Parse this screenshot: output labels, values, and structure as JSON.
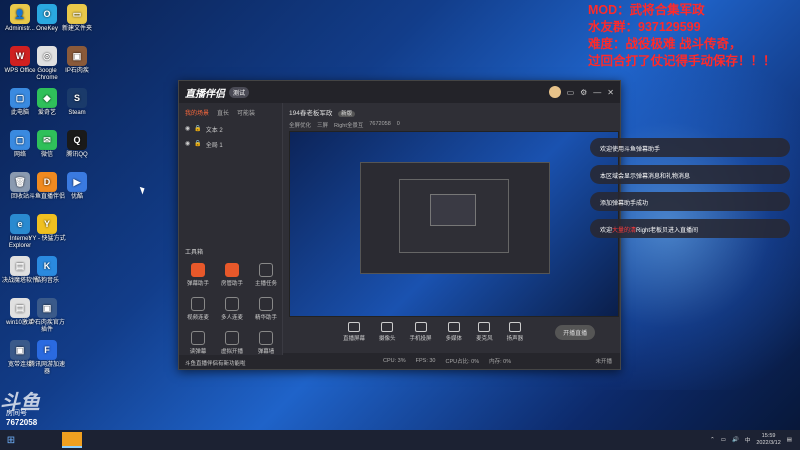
{
  "desktop": {
    "icons": [
      {
        "label": "Administr...",
        "color": "#e8c84a",
        "glyph": "👤"
      },
      {
        "label": "OneKey",
        "color": "#2aa8e0",
        "glyph": "O"
      },
      {
        "label": "新建文件夹",
        "color": "#e8c84a",
        "glyph": "▭"
      },
      {
        "label": "WPS Office",
        "color": "#d02020",
        "glyph": "W"
      },
      {
        "label": "Google Chrome",
        "color": "#e0e0e0",
        "glyph": "◎"
      },
      {
        "label": "IP石肉疾",
        "color": "#8a5a3a",
        "glyph": "▣"
      },
      {
        "label": "此电脑",
        "color": "#3a8ae0",
        "glyph": "▢"
      },
      {
        "label": "爱奇艺",
        "color": "#2fc05a",
        "glyph": "◆"
      },
      {
        "label": "Steam",
        "color": "#1a3a6a",
        "glyph": "S"
      },
      {
        "label": "网络",
        "color": "#3a8ae0",
        "glyph": "▢"
      },
      {
        "label": "微信",
        "color": "#2fc05a",
        "glyph": "✉"
      },
      {
        "label": "腾讯QQ",
        "color": "#1a1a1a",
        "glyph": "Q"
      },
      {
        "label": "回收站",
        "color": "#8a9ab0",
        "glyph": "🗑"
      },
      {
        "label": "斗鱼直播伴侣",
        "color": "#f08a20",
        "glyph": "D"
      },
      {
        "label": "优酷",
        "color": "#3a7ae0",
        "glyph": "▶"
      },
      {
        "label": "Internet Explorer",
        "color": "#2a8ad0",
        "glyph": "e"
      },
      {
        "label": "YY - 快猛方式",
        "color": "#f0c020",
        "glyph": "Y"
      },
      {
        "label": "",
        "color": "",
        "glyph": ""
      },
      {
        "label": "决战魔塔软件",
        "color": "#e0e0e0",
        "glyph": "▤"
      },
      {
        "label": "酷狗音乐",
        "color": "#2a8ae0",
        "glyph": "K"
      },
      {
        "label": "",
        "color": "",
        "glyph": ""
      },
      {
        "label": "win10激活",
        "color": "#e0e0e0",
        "glyph": "▤"
      },
      {
        "label": "IP石肉疾官方插件",
        "color": "#3a5a8a",
        "glyph": "▣"
      },
      {
        "label": "",
        "color": "",
        "glyph": ""
      },
      {
        "label": "宽带连接",
        "color": "#3a5a8a",
        "glyph": "▣"
      },
      {
        "label": "腾讯网游加速器",
        "color": "#2a6ae0",
        "glyph": "F"
      }
    ]
  },
  "overlay": {
    "line1": "MOD：武将合集军政",
    "line2": "水友群：937129599",
    "line3": "难度：战役极难 战斗传奇，",
    "line4": "过回合打了仗记得手动保存！！！"
  },
  "app": {
    "logo": "直播伴侣",
    "badge": "测试",
    "left_tabs": [
      "我的场景",
      "直长",
      "可能装"
    ],
    "layers": [
      {
        "name": "文本 2"
      },
      {
        "name": "全局 1"
      }
    ],
    "tools_title": "工具箱",
    "tools": [
      {
        "label": "弹幕助手",
        "hot": true
      },
      {
        "label": "房管助手",
        "hot": true
      },
      {
        "label": "主播任务",
        "hot": false
      },
      {
        "label": "视频连麦",
        "hot": false
      },
      {
        "label": "多人连麦",
        "hot": false
      },
      {
        "label": "精华助手",
        "hot": false
      },
      {
        "label": "读弹幕",
        "hot": false
      },
      {
        "label": "虚拟开播",
        "hot": false
      },
      {
        "label": "弹幕墙",
        "hot": false
      }
    ],
    "notice": "斗鱼直播伴侣有新功能啦",
    "room_title": "194春老板军政",
    "room_badge": "新版",
    "scene_info": [
      "全屏优化",
      "三屏",
      "Right全景互",
      "7672058",
      "0"
    ],
    "bottom_buttons": [
      "直播屏幕",
      "摄像头",
      "手机投屏",
      "多媒体",
      "麦克风",
      "扬声器"
    ],
    "start_label": "开播直播",
    "status": [
      "CPU: 3%",
      "FPS: 30",
      "CPU占比: 0%",
      "内存: 0%"
    ],
    "status_right": "未开播"
  },
  "chat": [
    {
      "prefix": "欢迎使用斗鱼弹幕助手",
      "highlight": "",
      "suffix": ""
    },
    {
      "prefix": "本区域会显示弹幕消息和礼物消息",
      "highlight": "",
      "suffix": ""
    },
    {
      "prefix": "添加弹幕助手成功",
      "highlight": "",
      "suffix": ""
    },
    {
      "prefix": "欢迎",
      "highlight": "大量的清",
      "suffix": "Right老板贝进入直播间"
    }
  ],
  "watermark": {
    "logo": "斗鱼",
    "room_label": "房间号",
    "room_id": "7672058"
  },
  "taskbar": {
    "time": "15:59",
    "date": "2022/3/12"
  }
}
